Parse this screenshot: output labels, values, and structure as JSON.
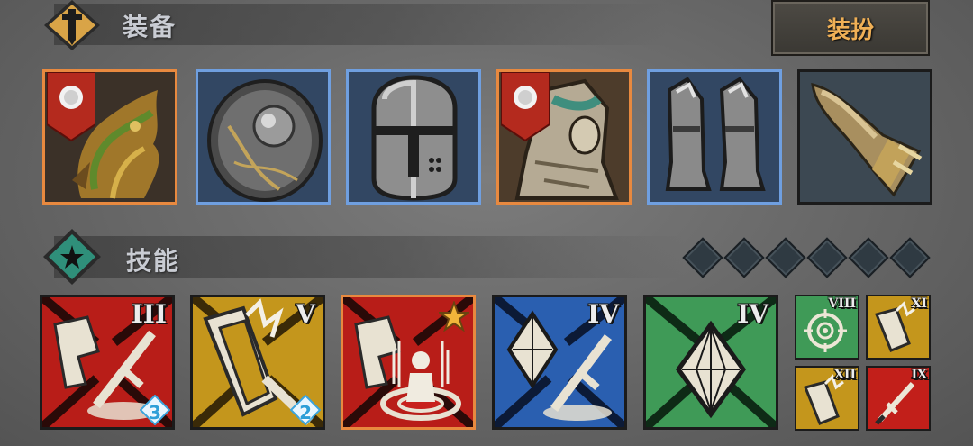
{
  "equipment": {
    "title": "装备",
    "dress_button": "装扮",
    "header_icon": "dagger-icon",
    "slots": [
      {
        "name": "dragon-armor-slot",
        "icon": "dragon-armor-icon",
        "rarity": "legendary",
        "banner": true
      },
      {
        "name": "shield-slot",
        "icon": "round-shield-icon",
        "rarity": "rare",
        "banner": false
      },
      {
        "name": "helmet-slot",
        "icon": "great-helm-icon",
        "rarity": "rare",
        "banner": false
      },
      {
        "name": "plate-armor-slot",
        "icon": "plate-armor-icon",
        "rarity": "legendary",
        "banner": true
      },
      {
        "name": "boots-slot",
        "icon": "armored-boots-icon",
        "rarity": "rare",
        "banner": false
      },
      {
        "name": "horn-slot",
        "icon": "horn-icon",
        "rarity": "common",
        "banner": false
      }
    ]
  },
  "skills": {
    "title": "技能",
    "header_icon": "star-icon",
    "empty_slot_count": 6,
    "main": [
      {
        "name": "skill-1",
        "icon": "charge-strike-icon",
        "color": "red",
        "numeral": "III",
        "gem": "3"
      },
      {
        "name": "skill-2",
        "icon": "shield-bash-icon",
        "color": "gold",
        "numeral": "V",
        "gem": "2"
      },
      {
        "name": "skill-3",
        "icon": "rally-icon",
        "color": "red",
        "numeral": "",
        "star": true
      },
      {
        "name": "skill-4",
        "icon": "crystal-sword-icon",
        "color": "blue",
        "numeral": "IV"
      },
      {
        "name": "skill-5",
        "icon": "crystal-icon",
        "color": "green",
        "numeral": "IV"
      }
    ],
    "mini": [
      {
        "name": "mini-skill-1",
        "icon": "crosshair-icon",
        "color": "green",
        "numeral": "VIII"
      },
      {
        "name": "mini-skill-2",
        "icon": "shield-bash-icon",
        "color": "gold",
        "numeral": "XI"
      },
      {
        "name": "mini-skill-3",
        "icon": "shield-bash-icon",
        "color": "gold",
        "numeral": "XII"
      },
      {
        "name": "mini-skill-4",
        "icon": "sword-icon",
        "color": "red",
        "numeral": "IX"
      }
    ]
  },
  "colors": {
    "legendary_border": "#e8893f",
    "rare_border": "#6f9fe0",
    "common_border": "#1b1b1b",
    "skill_red": "#c8201c",
    "skill_gold": "#c99a1a",
    "skill_blue": "#2b63b8",
    "skill_green": "#3f9a57"
  }
}
